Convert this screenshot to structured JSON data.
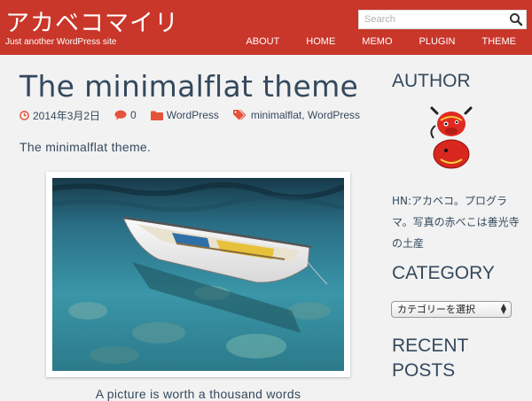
{
  "header": {
    "site_title": "アカベコマイリ",
    "site_description": "Just another WordPress site",
    "search": {
      "placeholder": "Search",
      "value": "",
      "icon": "search-icon"
    },
    "nav": [
      "ABOUT",
      "HOME",
      "MEMO",
      "PLUGIN",
      "THEME"
    ],
    "brand_color": "#c9362a"
  },
  "post": {
    "title": "The minimalflat theme",
    "date": "2014年3月2日",
    "comments": "0",
    "category": "WordPress",
    "tags": [
      "minimalflat",
      "WordPress"
    ],
    "tag_separator": ",",
    "excerpt": "The minimalflat theme.",
    "image_caption": "A picture is worth a thousand words",
    "accent_color": "#e4533a"
  },
  "sidebar": {
    "author_heading": "AUTHOR",
    "author_bio": "HN:アカベコ。プログラマ。写真の赤べこは善光寺の土産",
    "category_heading": "CATEGORY",
    "category_select": "カテゴリーを選択",
    "recent_heading": "RECENT POSTS"
  }
}
